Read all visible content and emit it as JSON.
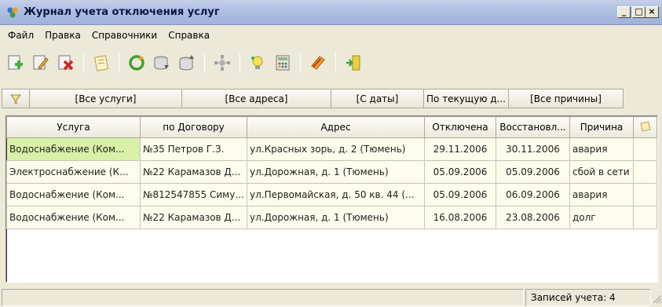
{
  "window": {
    "title": "Журнал учета отключения услуг",
    "minimize": "_",
    "maximize": "□",
    "close": "×"
  },
  "menu": [
    "Файл",
    "Правка",
    "Справочники",
    "Справка"
  ],
  "toolbar": {
    "groups": [
      [
        "add-icon",
        "edit-icon",
        "delete-icon"
      ],
      [
        "notepad-icon"
      ],
      [
        "refresh-icon",
        "db-import-icon",
        "db-export-icon"
      ],
      [
        "network-icon"
      ],
      [
        "bulb-icon",
        "calculator-icon"
      ],
      [
        "book-icon"
      ],
      [
        "exit-door-icon"
      ]
    ]
  },
  "filters": {
    "services": "[Все услуги]",
    "addresses": "[Все адреса]",
    "from_date": "[С даты]",
    "to_date": "По текущую д...",
    "reasons": "[Все причины]"
  },
  "grid": {
    "columns": [
      "Услуга",
      "по Договору",
      "Адрес",
      "Отключена",
      "Восстановл...",
      "Причина",
      ""
    ],
    "rows": [
      [
        "Водоснабжение (Ком...",
        "№35 Петров Г.З.",
        "ул.Красных зорь, д. 2 (Тюмень)",
        "29.11.2006",
        "30.11.2006",
        "авария",
        ""
      ],
      [
        "Электроснабжение (К...",
        "№22 Карамазов Д...",
        "ул.Дорожная, д. 1 (Тюмень)",
        "05.09.2006",
        "05.09.2006",
        "сбой в сети",
        ""
      ],
      [
        "Водоснабжение (Ком...",
        "№812547855 Симу...",
        "ул.Первомайская, д. 50 кв. 44 (...",
        "05.09.2006",
        "06.09.2006",
        "авария",
        ""
      ],
      [
        "Водоснабжение (Ком...",
        "№22 Карамазов Д...",
        "ул.Дорожная, д. 1 (Тюмень)",
        "16.08.2006",
        "23.08.2006",
        "долг",
        ""
      ]
    ]
  },
  "status": {
    "records": "Записей учета: 4"
  }
}
